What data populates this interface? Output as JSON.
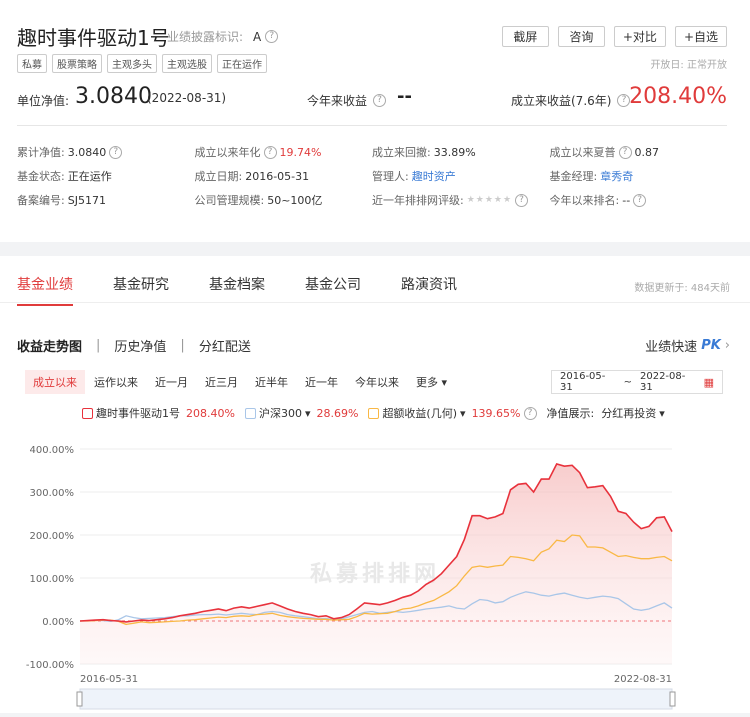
{
  "header": {
    "title": "趣时事件驱动1号",
    "disclosure_label": "业绩披露标识:",
    "disclosure_value": "A",
    "buttons": [
      "截屏",
      "咨询",
      "+对比",
      "+自选"
    ],
    "tags": [
      "私募",
      "股票策略",
      "主观多头",
      "主观选股",
      "正在运作"
    ],
    "open_day": "开放日: 正常开放",
    "nav_label": "单位净值:",
    "nav_value": "3.0840",
    "nav_date": "(2022-08-31)",
    "ytd_label": "今年来收益",
    "ytd_value": "--",
    "since_label": "成立来收益(7.6年)",
    "since_value": "208.40%"
  },
  "info": [
    [
      {
        "k": "累计净值:",
        "v": "3.0840",
        "q": true
      },
      {
        "k": "成立以来年化",
        "v": "19.74%",
        "q": true,
        "style": "red"
      },
      {
        "k": "成立来回撤:",
        "v": "33.89%"
      },
      {
        "k": "成立以来夏普",
        "v": "0.87",
        "q": true
      }
    ],
    [
      {
        "k": "基金状态:",
        "v": "正在运作"
      },
      {
        "k": "成立日期:",
        "v": "2016-05-31"
      },
      {
        "k": "管理人:",
        "v": "趣时资产",
        "style": "link"
      },
      {
        "k": "基金经理:",
        "v": "章秀奇",
        "style": "link"
      }
    ],
    [
      {
        "k": "备案编号:",
        "v": "SJ5171"
      },
      {
        "k": "公司管理规模:",
        "v": "50~100亿"
      },
      {
        "k": "近一年排排网评级:",
        "v": "",
        "stars": true,
        "q": true
      },
      {
        "k": "今年以来排名:",
        "v": "--",
        "q": true
      }
    ]
  ],
  "tabs": [
    "基金业绩",
    "基金研究",
    "基金档案",
    "基金公司",
    "路演资讯"
  ],
  "updated": "数据更新于: 484天前",
  "subtabs": [
    "收益走势图",
    "历史净值",
    "分红配送"
  ],
  "quick": {
    "label": "业绩快速",
    "pk": "PK"
  },
  "ranges": [
    "成立以来",
    "运作以来",
    "近一月",
    "近三月",
    "近半年",
    "近一年",
    "今年以来",
    "更多"
  ],
  "date_start": "2016-05-31",
  "date_sep": "~",
  "date_end": "2022-08-31",
  "legend": {
    "s1_name": "趣时事件驱动1号",
    "s1_pct": "208.40%",
    "s2_name": "沪深300",
    "s2_pct": "28.69%",
    "s3_name": "超额收益(几何)",
    "s3_pct": "139.65%",
    "nav_show_label": "净值展示:",
    "nav_show_value": "分红再投资"
  },
  "colors": {
    "fund": "#e8323c",
    "index": "#a9c6e8",
    "excess": "#f9b845",
    "accent": "#e03b3b"
  },
  "watermark": "私募排排网",
  "chart_data": {
    "type": "line",
    "ylabel": "",
    "ylim": [
      -100,
      400
    ],
    "yticks": [
      "400.00%",
      "300.00%",
      "200.00%",
      "100.00%",
      "0.00%",
      "-100.00%"
    ],
    "xticks": [
      "2016-05-31",
      "2022-08-31"
    ],
    "x_start": "2016-05-31",
    "x_end": "2022-08-31",
    "series": [
      {
        "name": "趣时事件驱动1号",
        "values": [
          0,
          1,
          2,
          3,
          1,
          0,
          -2,
          0,
          2,
          1,
          3,
          5,
          8,
          12,
          15,
          18,
          22,
          25,
          28,
          24,
          30,
          33,
          30,
          34,
          38,
          42,
          35,
          28,
          22,
          18,
          15,
          10,
          12,
          5,
          8,
          15,
          28,
          42,
          40,
          38,
          42,
          48,
          55,
          60,
          70,
          85,
          95,
          110,
          130,
          150,
          190,
          245,
          245,
          238,
          242,
          250,
          305,
          318,
          320,
          300,
          330,
          330,
          365,
          360,
          362,
          345,
          310,
          312,
          315,
          290,
          255,
          250,
          230,
          215,
          220,
          240,
          242,
          208
        ]
      },
      {
        "name": "沪深300",
        "values": [
          0,
          1,
          2,
          1,
          -1,
          3,
          12,
          8,
          5,
          6,
          7,
          8,
          10,
          12,
          12,
          14,
          15,
          15,
          16,
          14,
          16,
          18,
          16,
          15,
          20,
          22,
          20,
          15,
          12,
          10,
          8,
          5,
          6,
          3,
          5,
          10,
          15,
          20,
          22,
          18,
          20,
          22,
          20,
          22,
          25,
          28,
          30,
          32,
          35,
          30,
          28,
          40,
          50,
          48,
          42,
          45,
          55,
          62,
          68,
          65,
          60,
          58,
          62,
          65,
          60,
          55,
          52,
          55,
          58,
          56,
          52,
          40,
          28,
          25,
          28,
          35,
          42,
          30
        ]
      },
      {
        "name": "超额收益(几何)",
        "values": [
          0,
          0,
          1,
          2,
          2,
          -1,
          -8,
          -5,
          -2,
          -4,
          -3,
          -2,
          -1,
          0,
          2,
          3,
          5,
          7,
          9,
          8,
          11,
          12,
          11,
          15,
          16,
          18,
          13,
          10,
          8,
          6,
          5,
          4,
          4,
          2,
          3,
          4,
          10,
          18,
          16,
          17,
          18,
          22,
          28,
          30,
          35,
          42,
          48,
          58,
          68,
          82,
          105,
          125,
          128,
          125,
          128,
          130,
          150,
          148,
          145,
          140,
          160,
          168,
          188,
          185,
          200,
          198,
          172,
          172,
          170,
          160,
          150,
          152,
          148,
          145,
          145,
          148,
          150,
          140
        ]
      }
    ]
  }
}
